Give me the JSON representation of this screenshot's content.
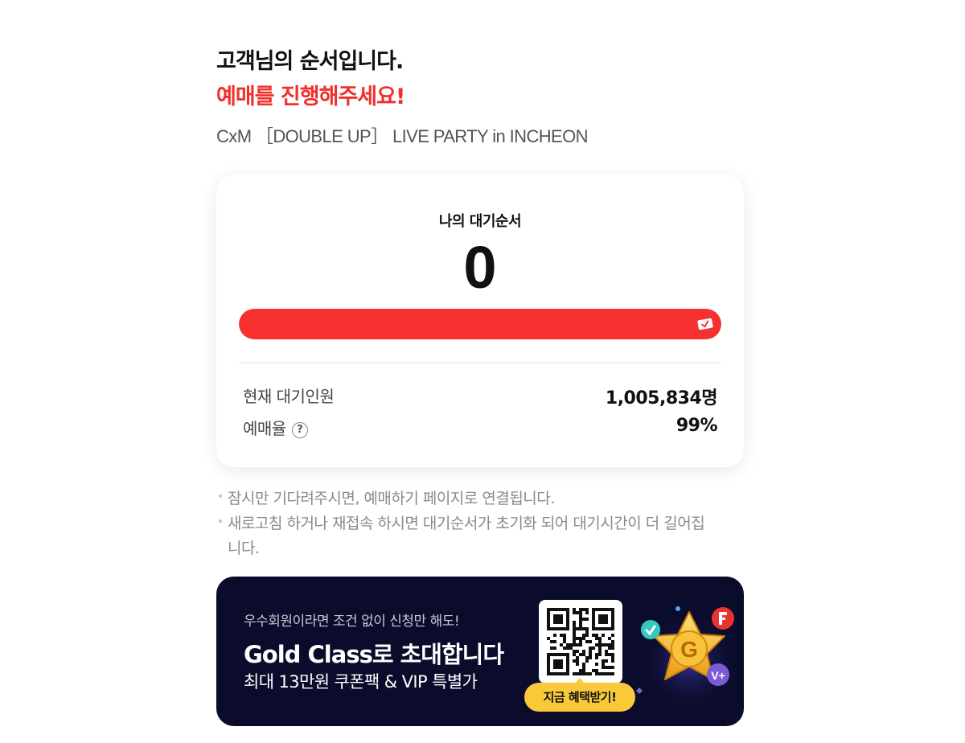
{
  "header": {
    "title": "고객님의 순서입니다.",
    "subtitle": "예매를 진행해주세요!",
    "event_name": "CxM ［DOUBLE UP］ LIVE PARTY in INCHEON"
  },
  "queue_card": {
    "label": "나의 대기순서",
    "position": "0",
    "progress_fraction": 1.0,
    "stats": [
      {
        "label": "현재 대기인원",
        "value": "1,005,834명"
      },
      {
        "label": "예매율",
        "value": "99%"
      }
    ],
    "help_symbol": "?"
  },
  "notes": [
    "잠시만 기다려주시면, 예매하기 페이지로 연결됩니다.",
    "새로고침 하거나 재접속 하시면 대기순서가 초기화 되어 대기시간이 더 길어집니다."
  ],
  "banner": {
    "sub": "우수회원이라면 조건 없이 신청만 해도!",
    "title": "Gold Class로 초대합니다",
    "desc": "최대 13만원 쿠폰팩 & VIP 특별가",
    "button_label": "지금 혜택받기!",
    "gold_letter": "G"
  },
  "colors": {
    "accent": "#f6302f",
    "banner_bg": "#0b0b2b",
    "button": "#f9c93a"
  },
  "icons": [
    "ticket-icon",
    "help-icon",
    "qr-code",
    "gold-star-icon"
  ]
}
